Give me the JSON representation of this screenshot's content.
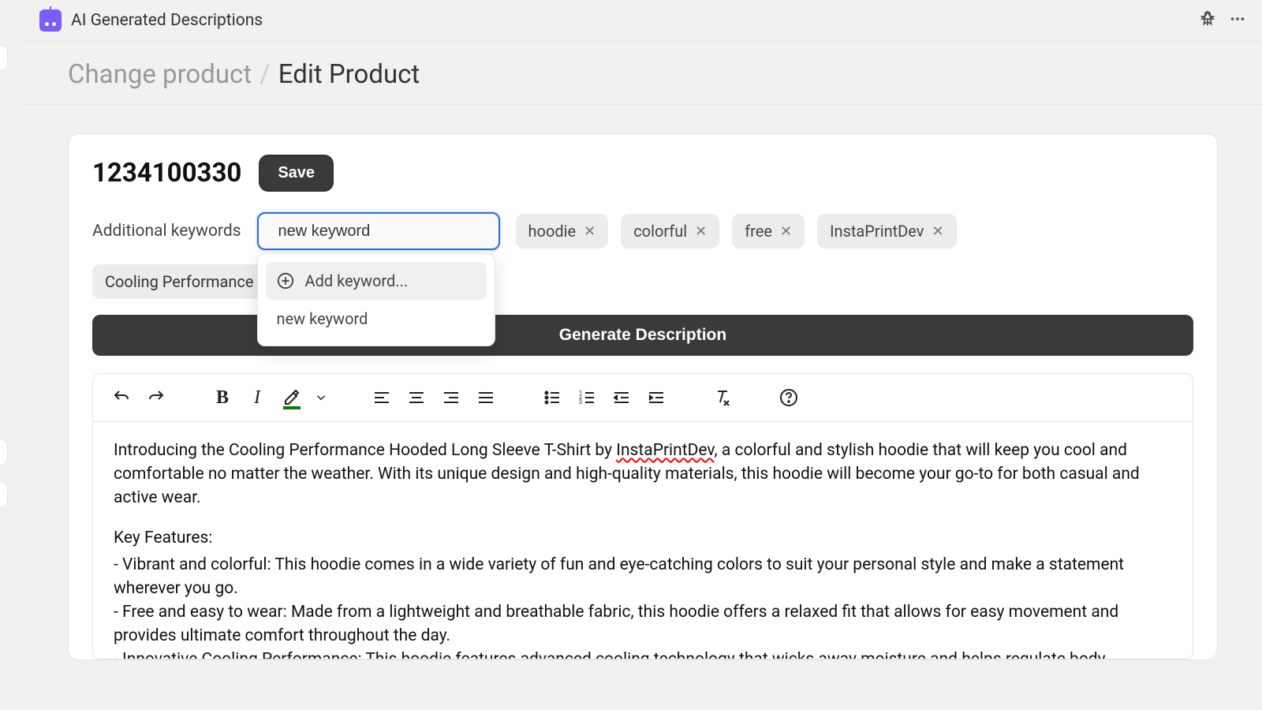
{
  "app": {
    "title": "AI Generated Descriptions"
  },
  "breadcrumb": {
    "parent": "Change product",
    "current": "Edit Product"
  },
  "product": {
    "id": "1234100330",
    "save_label": "Save"
  },
  "keywords": {
    "label": "Additional keywords",
    "input_value": "new keyword",
    "chips": [
      "hoodie",
      "colorful",
      "free",
      "InstaPrintDev"
    ]
  },
  "dropdown": {
    "add_label": "Add keyword...",
    "match": "new keyword"
  },
  "product_name_chip": "Cooling Performance Hooded Long Sleeve T-Shirt",
  "generate_label": "Generate Description",
  "editor": {
    "p1a": "Introducing the Cooling Performance Hooded Long Sleeve T-Shirt by ",
    "p1_spellerr": "InstaPrintDev",
    "p1b": ", a colorful and stylish hoodie that will keep you cool and comfortable no matter the weather. With its unique design and high-quality materials, this hoodie will become your go-to for both casual and active wear.",
    "key_features_label": "Key Features:",
    "b1": "- Vibrant and colorful: This hoodie comes in a wide variety of fun and eye-catching colors to suit your personal style and make a statement wherever you go.",
    "b2": "- Free and easy to wear: Made from a lightweight and breathable fabric, this hoodie offers a relaxed fit that allows for easy movement and provides ultimate comfort throughout the day.",
    "b3": "- Innovative Cooling Performance: This hoodie features advanced cooling technology that wicks away moisture and helps regulate body"
  }
}
